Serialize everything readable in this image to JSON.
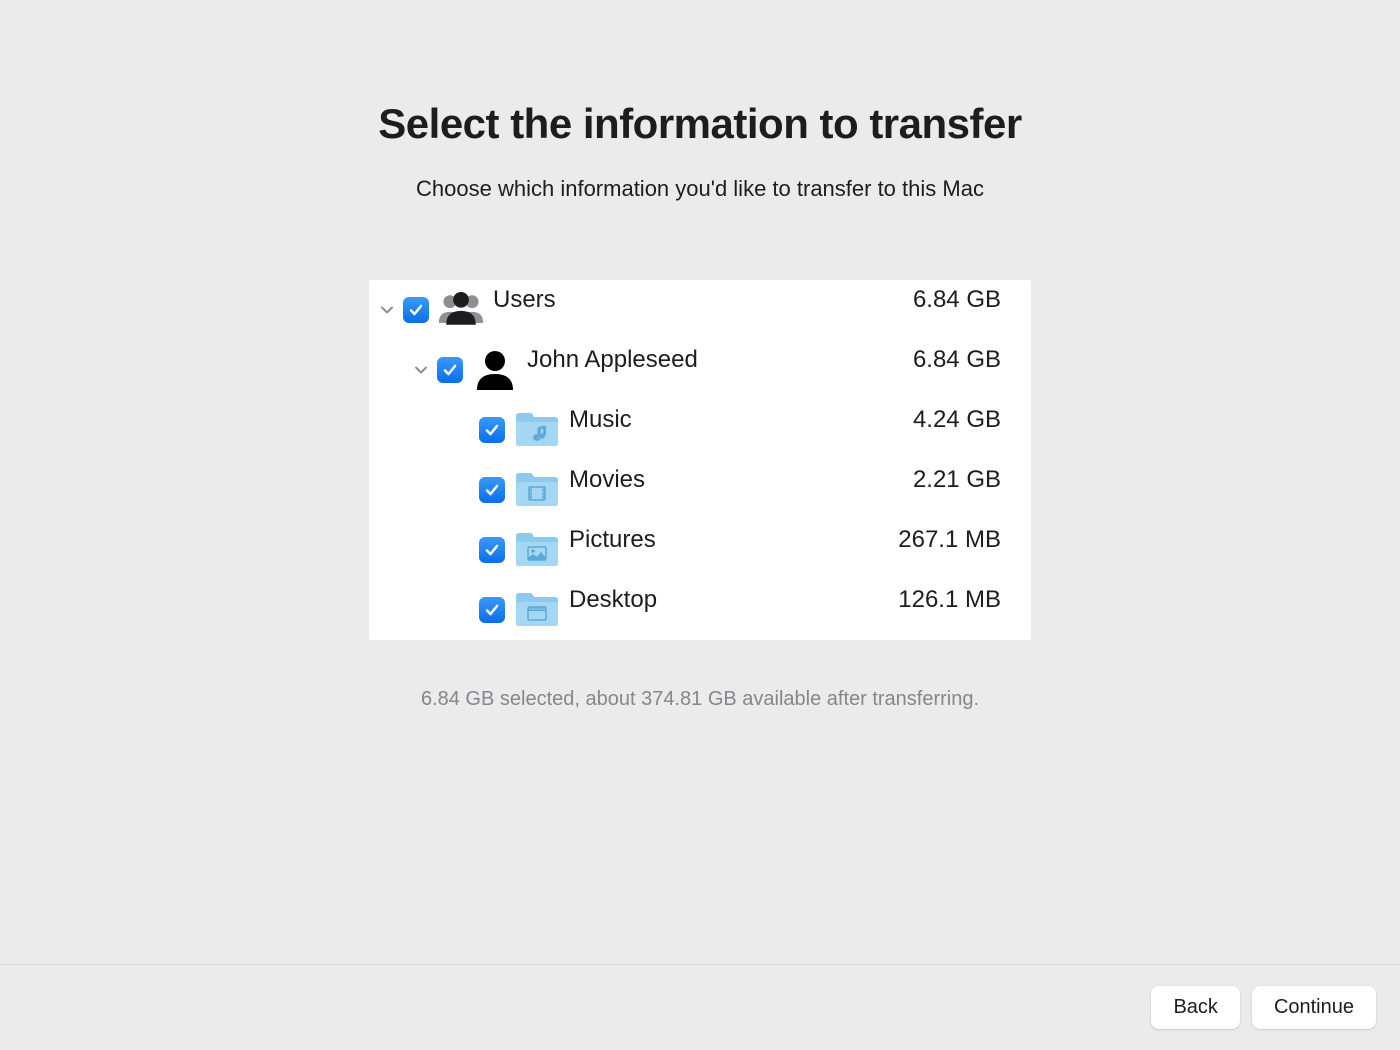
{
  "header": {
    "title": "Select the information to transfer",
    "subtitle": "Choose which information you'd like to transfer to this Mac"
  },
  "tree": {
    "users": {
      "label": "Users",
      "size": "6.84 GB",
      "user": {
        "label": "John Appleseed",
        "size": "6.84 GB",
        "folders": [
          {
            "label": "Music",
            "size": "4.24 GB",
            "icon": "music"
          },
          {
            "label": "Movies",
            "size": "2.21 GB",
            "icon": "movies"
          },
          {
            "label": "Pictures",
            "size": "267.1 MB",
            "icon": "pictures"
          },
          {
            "label": "Desktop",
            "size": "126.1 MB",
            "icon": "desktop"
          }
        ]
      }
    }
  },
  "status": "6.84 GB selected, about 374.81 GB available after transferring.",
  "footer": {
    "back": "Back",
    "continue": "Continue"
  },
  "colors": {
    "accent": "#0a7aff",
    "folder_light": "#a5d1f0",
    "folder_dark": "#74b8e8"
  }
}
